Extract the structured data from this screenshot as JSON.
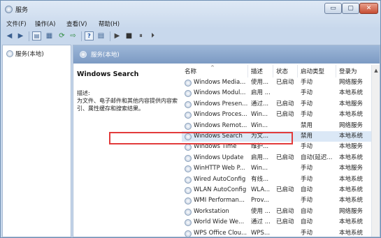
{
  "window": {
    "title": "服务",
    "buttons": {
      "minimize": "▭",
      "maximize": "▢",
      "close": "✕"
    }
  },
  "menu": [
    "文件(F)",
    "操作(A)",
    "查看(V)",
    "帮助(H)"
  ],
  "toolbar": [
    "◀",
    "▶",
    "▤",
    "▦",
    "⟳",
    "⇨",
    "?",
    "▤",
    "▶",
    "■",
    "⏸",
    "⏵"
  ],
  "tree": {
    "label": "服务(本地)"
  },
  "header": {
    "label": "服务(本地)"
  },
  "detail": {
    "title": "Windows Search",
    "desc_label": "描述:",
    "desc_text": "为文件、电子邮件和其他内容提供内容索引、属性缓存和搜索结果。"
  },
  "columns": [
    "名称",
    "描述",
    "状态",
    "启动类型",
    "登录为"
  ],
  "rows": [
    [
      "Windows Media...",
      "使用...",
      "已启动",
      "手动",
      "网络服务"
    ],
    [
      "Windows Modul...",
      "启用 ...",
      "",
      "手动",
      "本地系统"
    ],
    [
      "Windows Presen...",
      "通过...",
      "已启动",
      "手动",
      "本地服务"
    ],
    [
      "Windows Proces...",
      "Win...",
      "已启动",
      "手动",
      "本地系统"
    ],
    [
      "Windows Remot...",
      "Win...",
      "",
      "禁用",
      "网络服务"
    ],
    [
      "Windows Search",
      "为文...",
      "",
      "禁用",
      "本地系统"
    ],
    [
      "Windows Time",
      "维护...",
      "",
      "手动",
      "本地服务"
    ],
    [
      "Windows Update",
      "启用...",
      "已启动",
      "自动(延迟...",
      "本地系统"
    ],
    [
      "WinHTTP Web P...",
      "Win...",
      "",
      "手动",
      "本地服务"
    ],
    [
      "Wired AutoConfig",
      "有线...",
      "",
      "手动",
      "本地系统"
    ],
    [
      "WLAN AutoConfig",
      "WLA...",
      "已启动",
      "自动",
      "本地系统"
    ],
    [
      "WMI Performan...",
      "Prov...",
      "",
      "手动",
      "本地系统"
    ],
    [
      "Workstation",
      "使用 ...",
      "已启动",
      "自动",
      "网络服务"
    ],
    [
      "World Wide We...",
      "通过 ...",
      "已启动",
      "自动",
      "本地系统"
    ],
    [
      "WPS Office Clou...",
      "WPS...",
      "",
      "手动",
      "本地系统"
    ]
  ],
  "selected_row": 5,
  "colors": {
    "highlight": "#e23b3b",
    "header": "#8aa6cc"
  }
}
